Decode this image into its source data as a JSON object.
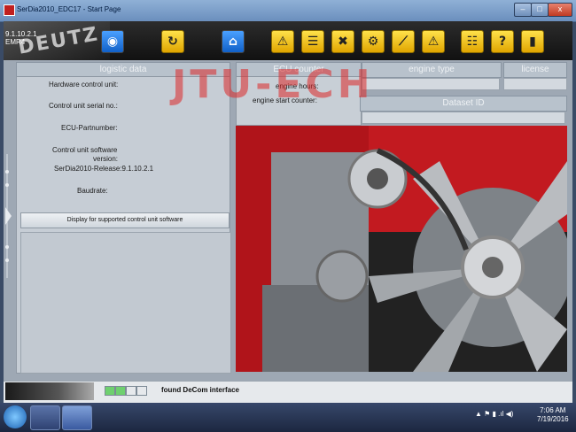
{
  "window": {
    "title": "SerDia2010_EDC17 - Start Page",
    "minimize": "–",
    "maximize": "□",
    "close": "x"
  },
  "app": {
    "version_line1": "9.1.10.2.1",
    "version_line2": "EMR4",
    "brand": "DEUTZ"
  },
  "toolbar": {
    "items": [
      {
        "icon": "camera-icon",
        "glyph": "◉"
      },
      {
        "icon": "refresh-icon",
        "glyph": "↻"
      },
      {
        "icon": "home-icon",
        "glyph": "⌂"
      },
      {
        "icon": "warning-icon",
        "glyph": "⚠"
      },
      {
        "icon": "document-icon",
        "glyph": "☰"
      },
      {
        "icon": "tools-icon",
        "glyph": "✖"
      },
      {
        "icon": "gear-icon",
        "glyph": "⚙"
      },
      {
        "icon": "chart-icon",
        "glyph": "⟋"
      },
      {
        "icon": "alert-icon",
        "glyph": "⚠"
      },
      {
        "icon": "sliders-icon",
        "glyph": "☷"
      },
      {
        "icon": "help-icon",
        "glyph": "?"
      },
      {
        "icon": "exit-icon",
        "glyph": "▮"
      }
    ]
  },
  "logistic": {
    "header": "logistic data",
    "hardware_label": "Hardware control unit:",
    "serial_label": "Control unit serial no.:",
    "partnumber_label": "ECU-Partnumber:",
    "software_label1": "Control unit software",
    "software_label2": "version:",
    "software_value": "SerDia2010-Release:9.1.10.2.1",
    "baudrate_label": "Baudrate:",
    "display_button": "Display for supported control unit software"
  },
  "ecu_counter": {
    "header": "ECU counter",
    "engine_hours": "engine hours:",
    "start_counter": "engine start counter:"
  },
  "engine_type": {
    "header": "engine type"
  },
  "license": {
    "header": "license"
  },
  "dataset": {
    "header": "Dataset ID"
  },
  "watermark": "JTU-ECH",
  "status": {
    "text": "found DeCom interface"
  },
  "taskbar": {
    "time": "7:06 AM",
    "date": "7/19/2016"
  }
}
